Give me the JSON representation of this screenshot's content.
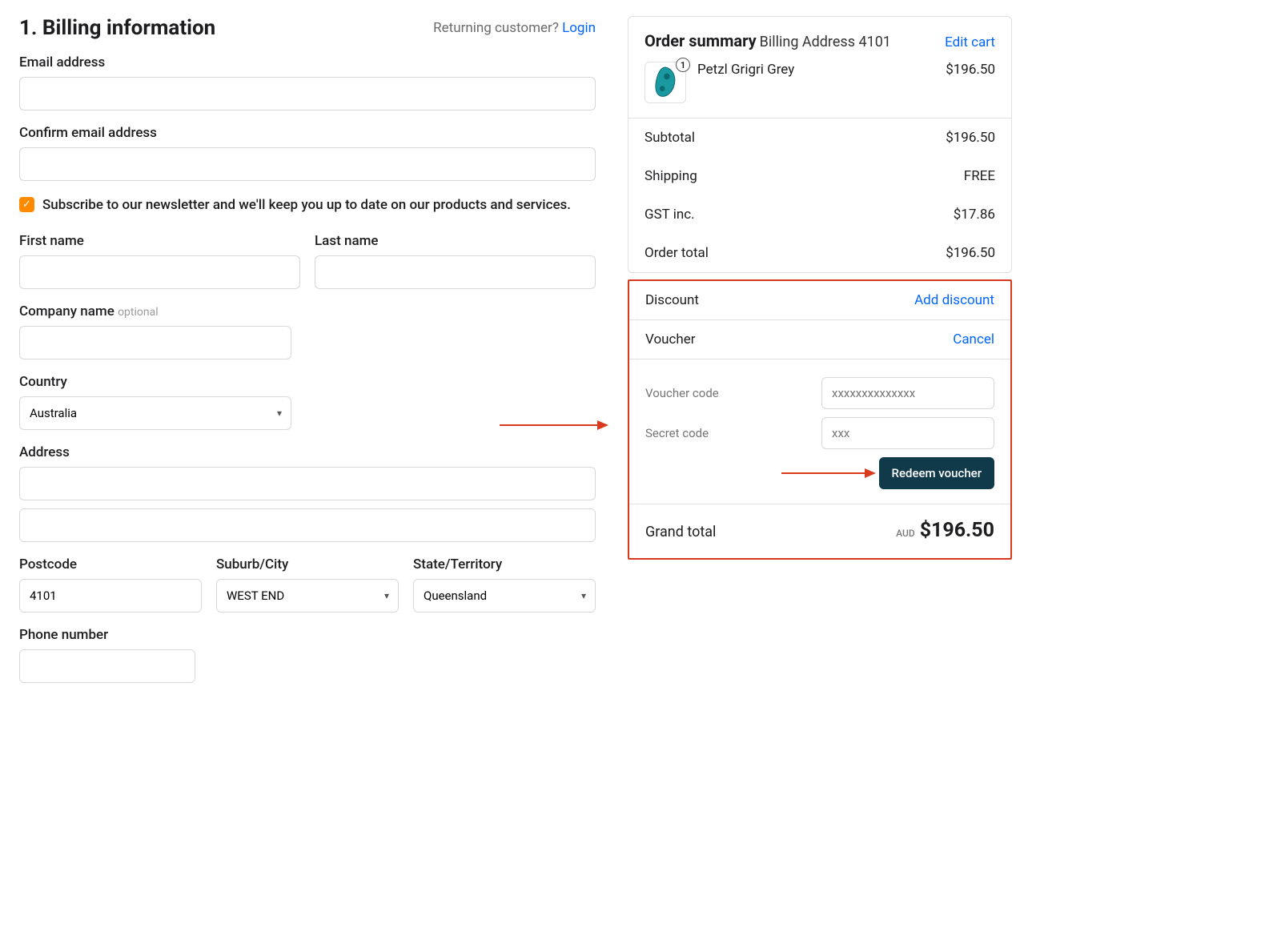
{
  "billing": {
    "title": "1. Billing information",
    "returning_text": "Returning customer? ",
    "login_label": "Login",
    "labels": {
      "email": "Email address",
      "confirm_email": "Confirm email address",
      "newsletter": "Subscribe to our newsletter and we'll keep you up to date on our products and services.",
      "first_name": "First name",
      "last_name": "Last name",
      "company": "Company name",
      "company_optional": "optional",
      "country": "Country",
      "address": "Address",
      "postcode": "Postcode",
      "suburb": "Suburb/City",
      "state": "State/Territory",
      "phone": "Phone number"
    },
    "values": {
      "country": "Australia",
      "postcode": "4101",
      "suburb": "WEST END",
      "state": "Queensland"
    }
  },
  "summary": {
    "title": "Order summary",
    "sub": "Billing Address 4101",
    "edit_label": "Edit cart",
    "product": {
      "qty": "1",
      "name": "Petzl Grigri Grey",
      "price": "$196.50"
    },
    "lines": {
      "subtotal_label": "Subtotal",
      "subtotal_value": "$196.50",
      "shipping_label": "Shipping",
      "shipping_value": "FREE",
      "gst_label": "GST inc.",
      "gst_value": "$17.86",
      "order_total_label": "Order total",
      "order_total_value": "$196.50"
    },
    "discount": {
      "label": "Discount",
      "add_label": "Add discount"
    },
    "voucher": {
      "label": "Voucher",
      "cancel_label": "Cancel",
      "code_label": "Voucher code",
      "code_placeholder": "xxxxxxxxxxxxxx",
      "secret_label": "Secret code",
      "secret_placeholder": "xxx",
      "redeem_label": "Redeem voucher"
    },
    "grand": {
      "label": "Grand total",
      "currency": "AUD",
      "amount": "$196.50"
    }
  }
}
